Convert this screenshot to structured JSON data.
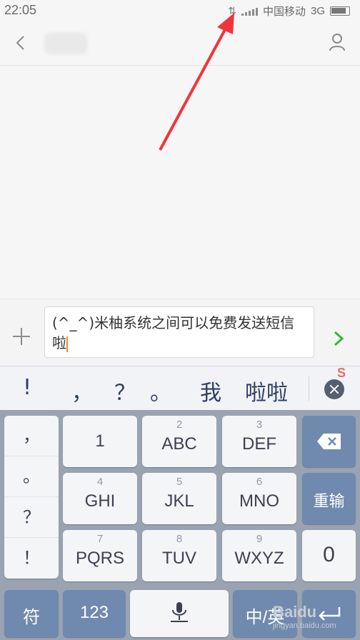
{
  "status_bar": {
    "time": "22:05",
    "carrier": "中国移动",
    "network": "3G"
  },
  "compose": {
    "text": "(^_^)米柚系统之间可以免费发送短信啦"
  },
  "candidates": [
    "!",
    "，",
    "？",
    "。",
    "我",
    "啦啦"
  ],
  "keyboard": {
    "punct": [
      "，",
      "。",
      "？",
      "！"
    ],
    "keys": [
      {
        "num": "",
        "letters": "1"
      },
      {
        "num": "2",
        "letters": "ABC"
      },
      {
        "num": "3",
        "letters": "DEF"
      },
      {
        "num": "4",
        "letters": "GHI"
      },
      {
        "num": "5",
        "letters": "JKL"
      },
      {
        "num": "6",
        "letters": "MNO"
      },
      {
        "num": "7",
        "letters": "PQRS"
      },
      {
        "num": "8",
        "letters": "TUV"
      },
      {
        "num": "9",
        "letters": "WXYZ"
      }
    ],
    "reenter": "重输",
    "zero": "0",
    "symbol": "符",
    "numbers": "123",
    "lang": "中/英"
  },
  "watermark": {
    "brand": "Baidu",
    "url": "jingyan.baidu.com"
  },
  "icons": {
    "back": "chevron-left-icon",
    "contact": "person-icon",
    "add": "plus-icon",
    "send": "chevron-right-icon",
    "clear": "clear-circle-icon",
    "backspace": "backspace-icon",
    "voice": "microphone-icon"
  },
  "colors": {
    "send": "#3bb33b",
    "caret": "#f08a24",
    "arrow": "#f2343a",
    "keyboard_blue": "#6f8aae"
  }
}
